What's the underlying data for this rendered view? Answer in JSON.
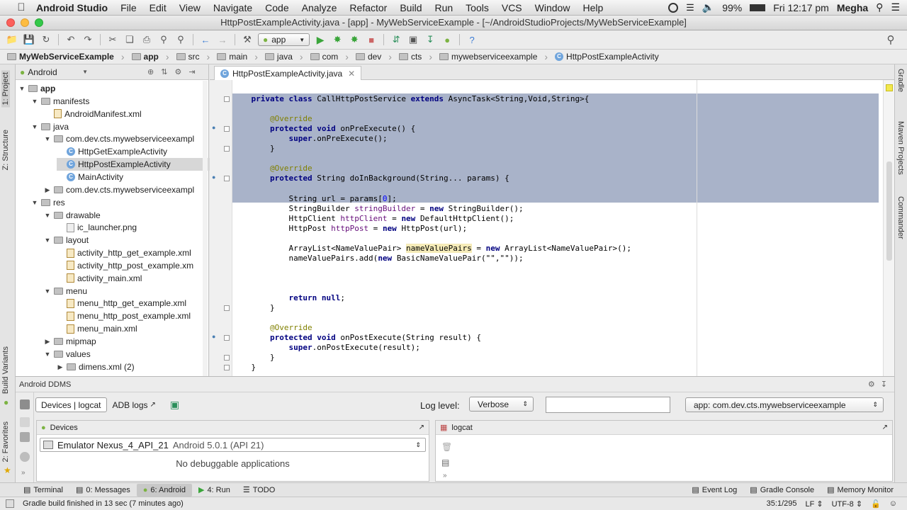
{
  "menubar": {
    "app": "Android Studio",
    "items": [
      "File",
      "Edit",
      "View",
      "Navigate",
      "Code",
      "Analyze",
      "Refactor",
      "Build",
      "Run",
      "Tools",
      "VCS",
      "Window",
      "Help"
    ],
    "battery": "99%",
    "clock": "Fri 12:17 pm",
    "user": "Megha"
  },
  "window": {
    "title": "HttpPostExampleActivity.java - [app] - MyWebServiceExample - [~/AndroidStudioProjects/MyWebServiceExample]"
  },
  "toolbar": {
    "run_config": "app"
  },
  "breadcrumbs": [
    "MyWebServiceExample",
    "app",
    "src",
    "main",
    "java",
    "com",
    "dev",
    "cts",
    "mywebserviceexample",
    "HttpPostExampleActivity"
  ],
  "left_strip": {
    "project": "1: Project",
    "structure": "Z: Structure",
    "build_variants": "Build Variants",
    "favorites": "2: Favorites"
  },
  "right_strip": {
    "gradle": "Gradle",
    "maven": "Maven Projects",
    "commander": "Commander"
  },
  "project": {
    "view": "Android",
    "tree": [
      {
        "label": "app",
        "level": 0,
        "arrow": "down",
        "icon": "folder",
        "bold": true
      },
      {
        "label": "manifests",
        "level": 1,
        "arrow": "down",
        "icon": "folder"
      },
      {
        "label": "AndroidManifest.xml",
        "level": 2,
        "arrow": "",
        "icon": "xml"
      },
      {
        "label": "java",
        "level": 1,
        "arrow": "down",
        "icon": "folder"
      },
      {
        "label": "com.dev.cts.mywebserviceexampl",
        "level": 2,
        "arrow": "down",
        "icon": "folder"
      },
      {
        "label": "HttpGetExampleActivity",
        "level": 3,
        "arrow": "",
        "icon": "class"
      },
      {
        "label": "HttpPostExampleActivity",
        "level": 3,
        "arrow": "",
        "icon": "class",
        "selected": true
      },
      {
        "label": "MainActivity",
        "level": 3,
        "arrow": "",
        "icon": "class"
      },
      {
        "label": "com.dev.cts.mywebserviceexampl",
        "level": 2,
        "arrow": "right",
        "icon": "folder"
      },
      {
        "label": "res",
        "level": 1,
        "arrow": "down",
        "icon": "folder"
      },
      {
        "label": "drawable",
        "level": 2,
        "arrow": "down",
        "icon": "folder"
      },
      {
        "label": "ic_launcher.png",
        "level": 3,
        "arrow": "",
        "icon": "png"
      },
      {
        "label": "layout",
        "level": 2,
        "arrow": "down",
        "icon": "folder"
      },
      {
        "label": "activity_http_get_example.xml",
        "level": 3,
        "arrow": "",
        "icon": "xml"
      },
      {
        "label": "activity_http_post_example.xm",
        "level": 3,
        "arrow": "",
        "icon": "xml"
      },
      {
        "label": "activity_main.xml",
        "level": 3,
        "arrow": "",
        "icon": "xml"
      },
      {
        "label": "menu",
        "level": 2,
        "arrow": "down",
        "icon": "folder"
      },
      {
        "label": "menu_http_get_example.xml",
        "level": 3,
        "arrow": "",
        "icon": "xml"
      },
      {
        "label": "menu_http_post_example.xml",
        "level": 3,
        "arrow": "",
        "icon": "xml"
      },
      {
        "label": "menu_main.xml",
        "level": 3,
        "arrow": "",
        "icon": "xml"
      },
      {
        "label": "mipmap",
        "level": 2,
        "arrow": "right",
        "icon": "folder"
      },
      {
        "label": "values",
        "level": 2,
        "arrow": "down",
        "icon": "folder"
      },
      {
        "label": "dimens.xml (2)",
        "level": 3,
        "arrow": "right",
        "icon": "folder"
      }
    ]
  },
  "editor": {
    "tab": "HttpPostExampleActivity.java",
    "lines": [
      [
        {
          "t": "    "
        },
        {
          "t": "private class ",
          "c": "kw"
        },
        {
          "t": "CallHttpPostService "
        },
        {
          "t": "extends ",
          "c": "kw"
        },
        {
          "t": "AsyncTask<String,Void,String>{"
        }
      ],
      [
        {
          "t": ""
        }
      ],
      [
        {
          "t": "        "
        },
        {
          "t": "@Override",
          "c": "an"
        }
      ],
      [
        {
          "t": "        "
        },
        {
          "t": "protected void ",
          "c": "kw"
        },
        {
          "t": "onPreExecute() {"
        }
      ],
      [
        {
          "t": "            "
        },
        {
          "t": "super",
          "c": "kw"
        },
        {
          "t": ".onPreExecute();"
        }
      ],
      [
        {
          "t": "        }"
        }
      ],
      [
        {
          "t": ""
        }
      ],
      [
        {
          "t": "        "
        },
        {
          "t": "@Override",
          "c": "an"
        }
      ],
      [
        {
          "t": "        "
        },
        {
          "t": "protected ",
          "c": "kw"
        },
        {
          "t": "String doInBackground(String... params) {"
        }
      ],
      [
        {
          "t": ""
        }
      ],
      [
        {
          "t": "            String url = params["
        },
        {
          "t": "0",
          "c": "num"
        },
        {
          "t": "];"
        }
      ],
      [
        {
          "t": "            StringBuilder "
        },
        {
          "t": "stringBuilder",
          "c": "fd"
        },
        {
          "t": " = "
        },
        {
          "t": "new ",
          "c": "kw"
        },
        {
          "t": "StringBuilder();"
        }
      ],
      [
        {
          "t": "            HttpClient "
        },
        {
          "t": "httpClient",
          "c": "fd"
        },
        {
          "t": " = "
        },
        {
          "t": "new ",
          "c": "kw"
        },
        {
          "t": "DefaultHttpClient();"
        }
      ],
      [
        {
          "t": "            HttpPost "
        },
        {
          "t": "httpPost",
          "c": "fd"
        },
        {
          "t": " = "
        },
        {
          "t": "new ",
          "c": "kw"
        },
        {
          "t": "HttpPost(url);"
        }
      ],
      [
        {
          "t": ""
        }
      ],
      [
        {
          "t": "            ArrayList<NameValuePair> "
        },
        {
          "t": "nameValuePairs",
          "c": "hl"
        },
        {
          "t": " = "
        },
        {
          "t": "new ",
          "c": "kw"
        },
        {
          "t": "ArrayList<NameValuePair>();"
        }
      ],
      [
        {
          "t": "            nameValuePairs.add("
        },
        {
          "t": "new ",
          "c": "kw"
        },
        {
          "t": "BasicNameValuePair(\"\",\"\"));"
        }
      ],
      [
        {
          "t": ""
        }
      ],
      [
        {
          "t": ""
        }
      ],
      [
        {
          "t": ""
        }
      ],
      [
        {
          "t": "            "
        },
        {
          "t": "return null",
          "c": "kw"
        },
        {
          "t": ";"
        }
      ],
      [
        {
          "t": "        }"
        }
      ],
      [
        {
          "t": ""
        }
      ],
      [
        {
          "t": "        "
        },
        {
          "t": "@Override",
          "c": "an"
        }
      ],
      [
        {
          "t": "        "
        },
        {
          "t": "protected void ",
          "c": "kw"
        },
        {
          "t": "onPostExecute(String result) {"
        }
      ],
      [
        {
          "t": "            "
        },
        {
          "t": "super",
          "c": "kw"
        },
        {
          "t": ".onPostExecute(result);"
        }
      ],
      [
        {
          "t": "        }"
        }
      ],
      [
        {
          "t": "    }"
        }
      ]
    ]
  },
  "ddms": {
    "title": "Android DDMS",
    "tab_devices": "Devices | logcat",
    "tab_adb": "ADB logs",
    "log_level_label": "Log level:",
    "log_level": "Verbose",
    "search_value": "",
    "app_filter": "app: com.dev.cts.mywebserviceexample",
    "devices_title": "Devices",
    "logcat_title": "logcat",
    "device_name": "Emulator Nexus_4_API_21",
    "device_version": "Android 5.0.1 (API 21)",
    "no_apps": "No debuggable applications"
  },
  "bottom_tabs": {
    "terminal": "Terminal",
    "messages": "0: Messages",
    "android": "6: Android",
    "run": "4: Run",
    "todo": "TODO",
    "event_log": "Event Log",
    "gradle_console": "Gradle Console",
    "memory_monitor": "Memory Monitor"
  },
  "status": {
    "message": "Gradle build finished in 13 sec (7 minutes ago)",
    "position": "35:1/295",
    "line_sep": "LF",
    "encoding": "UTF-8"
  }
}
